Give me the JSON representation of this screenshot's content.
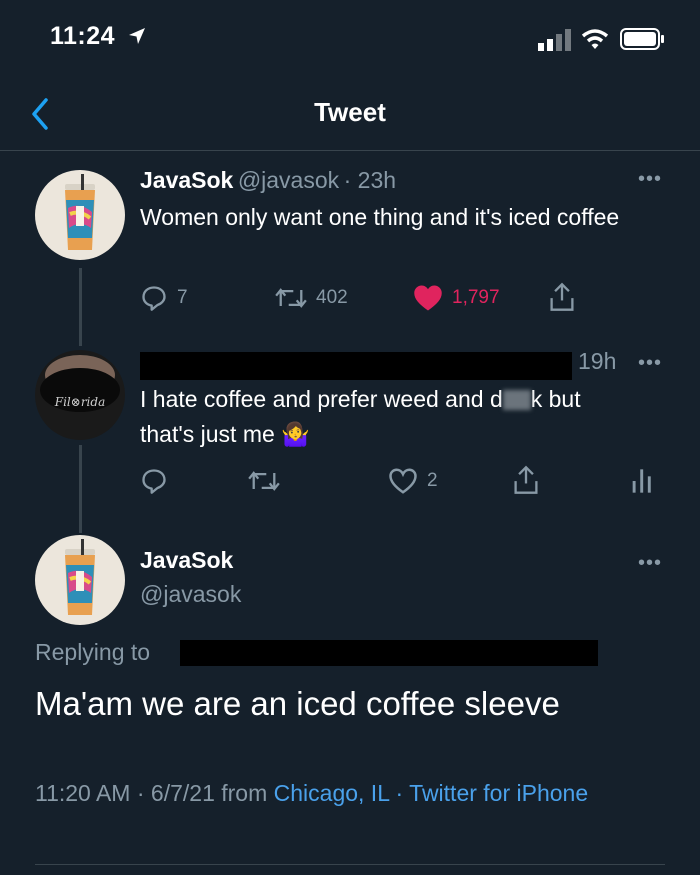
{
  "status_bar": {
    "time": "11:24"
  },
  "nav": {
    "title": "Tweet"
  },
  "tweet1": {
    "name": "JavaSok",
    "handle": "@javasok",
    "time": "· 23h",
    "text": "Women only want one thing and it's iced coffee",
    "replies": "7",
    "retweets": "402",
    "likes": "1,797",
    "like_color": "#e0245e"
  },
  "tweet2": {
    "time": "19h",
    "text_line1": "I hate coffee and prefer weed and d",
    "text_line1b": "k but",
    "text_line2": "that's just me 🤷‍♀️",
    "likes": "2"
  },
  "main_tweet": {
    "name": "JavaSok",
    "handle": "@javasok",
    "replying_label": "Replying to",
    "text": "Ma'am we are an iced coffee sleeve",
    "time": "11:20 AM · 6/7/21 from",
    "location": "Chicago, IL",
    "client": "· Twitter for iPhone"
  },
  "colors": {
    "background": "#15202b",
    "accent": "#1da1f2",
    "muted": "#8899a6"
  }
}
